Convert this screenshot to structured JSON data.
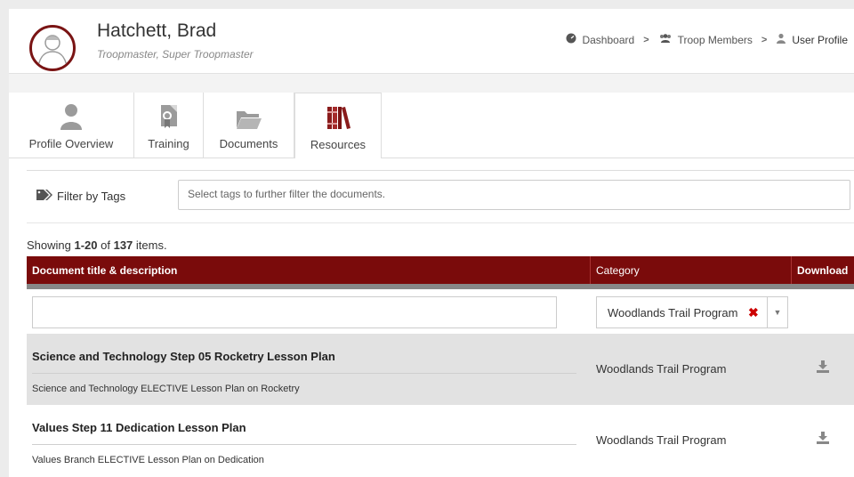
{
  "profile": {
    "name": "Hatchett, Brad",
    "role": "Troopmaster, Super Troopmaster"
  },
  "breadcrumb": {
    "items": [
      "Dashboard",
      "Troop Members",
      "User Profile"
    ],
    "separator": ">"
  },
  "tabs": [
    {
      "label": "Profile Overview",
      "icon": "user-icon"
    },
    {
      "label": "Training",
      "icon": "certificate-icon"
    },
    {
      "label": "Documents",
      "icon": "folder-open-icon"
    },
    {
      "label": "Resources",
      "icon": "books-icon",
      "active": true
    }
  ],
  "filter": {
    "label": "Filter by Tags",
    "placeholder": "Select tags to further filter the documents."
  },
  "summary": {
    "prefix": "Showing ",
    "range": "1-20",
    "of": " of ",
    "total": "137",
    "suffix": " items."
  },
  "table": {
    "columns": [
      "Document title & description",
      "Category",
      "Download"
    ],
    "category_filter": "Woodlands Trail Program",
    "rows": [
      {
        "title": "Science and Technology Step 05 Rocketry Lesson Plan",
        "description": "Science and Technology ELECTIVE Lesson Plan on Rocketry",
        "category": "Woodlands Trail Program"
      },
      {
        "title": "Values Step 11 Dedication Lesson Plan",
        "description": "Values Branch ELECTIVE Lesson Plan on Dedication",
        "category": "Woodlands Trail Program"
      }
    ]
  },
  "colors": {
    "accent": "#7a0b0b",
    "row_shade": "#e2e2e2"
  }
}
